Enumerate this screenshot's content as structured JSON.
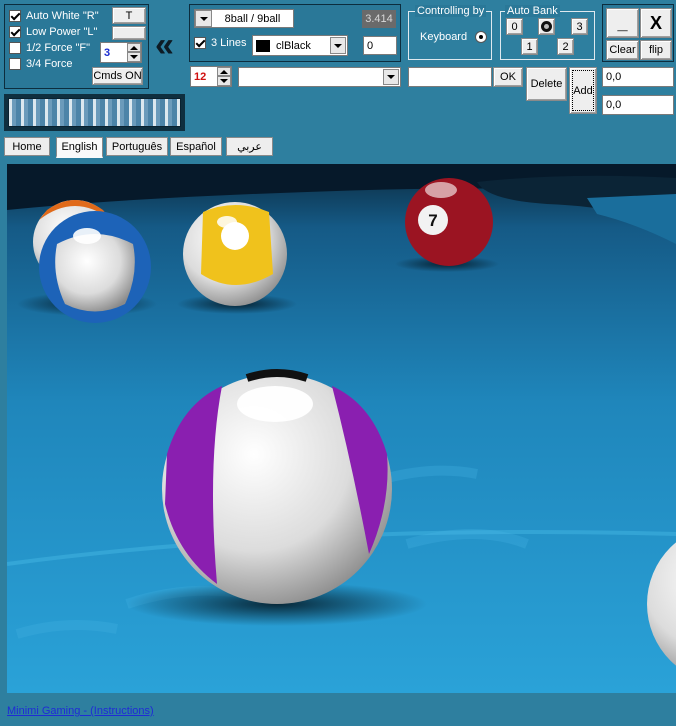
{
  "controls": {
    "auto_white": {
      "label": "Auto White \"R\"",
      "checked": true
    },
    "low_power": {
      "label": "Low Power \"L\"",
      "checked": true
    },
    "half_force": {
      "label": "1/2 Force \"F\"",
      "checked": false
    },
    "three_quarter_force": {
      "label": "3/4 Force",
      "checked": false
    },
    "t_button": "T",
    "force_value": "3",
    "cmds_button": "Cmds ON",
    "collapse_glyph": "«"
  },
  "game": {
    "mode_label": "8ball / 9ball",
    "mode_value": "3.414",
    "three_lines": {
      "label": "3 Lines",
      "checked": true
    },
    "color_value": "clBlack",
    "color_swatch": "#000000",
    "lines_value": "0",
    "number_value": "12",
    "combo_value": ""
  },
  "controlling": {
    "legend": "Controlling by",
    "option_label": "Keyboard"
  },
  "auto_bank": {
    "legend": "Auto Bank",
    "buttons": [
      "0",
      "3",
      "1",
      "2"
    ]
  },
  "window": {
    "minimize": "_",
    "close": "X",
    "clear": "Clear",
    "flip": "flip"
  },
  "input_row": {
    "text_value": "",
    "ok": "OK",
    "delete": "Delete",
    "add": "Add",
    "coord_1": "0,0",
    "coord_2": "0,0"
  },
  "tabs": [
    "Home",
    "English",
    "Português",
    "Español",
    "عربي"
  ],
  "active_tab": "English",
  "footer": {
    "link": "Minimi Gaming - (Instructions)"
  },
  "colors": {
    "background": "#2e7f9f",
    "number_red": "#d01010",
    "force_blue": "#1a2bd0",
    "table_cloth": "#2596c8"
  }
}
